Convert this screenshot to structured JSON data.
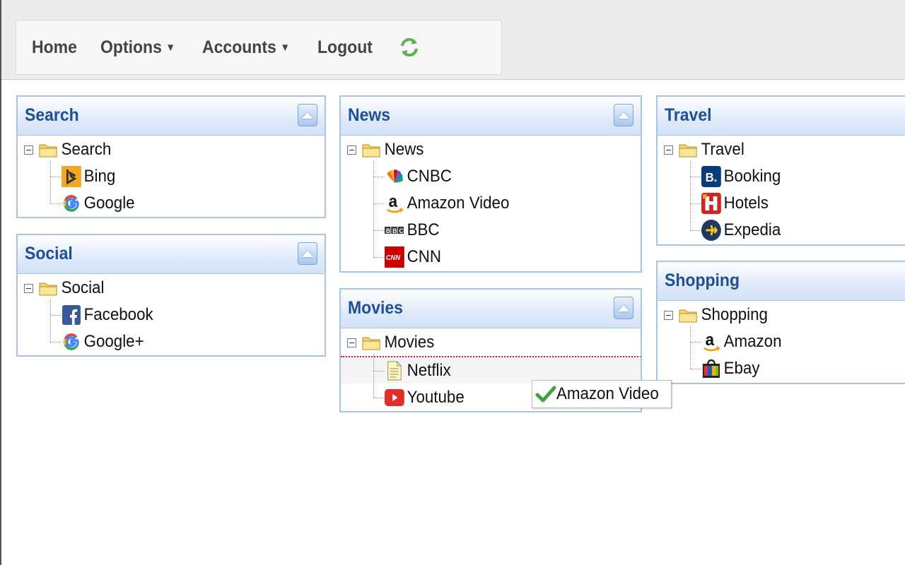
{
  "nav": {
    "home": "Home",
    "options": "Options",
    "accounts": "Accounts",
    "logout": "Logout"
  },
  "panels": {
    "search": {
      "title": "Search",
      "folder": "Search",
      "items": [
        "Bing",
        "Google"
      ]
    },
    "social": {
      "title": "Social",
      "folder": "Social",
      "items": [
        "Facebook",
        "Google+"
      ]
    },
    "news": {
      "title": "News",
      "folder": "News",
      "items": [
        "CNBC",
        "Amazon Video",
        "BBC",
        "CNN"
      ]
    },
    "movies": {
      "title": "Movies",
      "folder": "Movies",
      "items": [
        "Netflix",
        "Youtube"
      ]
    },
    "travel": {
      "title": "Travel",
      "folder": "Travel",
      "items": [
        "Booking",
        "Hotels",
        "Expedia"
      ]
    },
    "shopping": {
      "title": "Shopping",
      "folder": "Shopping",
      "items": [
        "Amazon",
        "Ebay"
      ]
    }
  },
  "drag": {
    "label": "Amazon Video"
  },
  "colors": {
    "header_text": "#1d4f9a",
    "panel_border": "#a8c4e8",
    "drop_indicator": "#e02020"
  }
}
